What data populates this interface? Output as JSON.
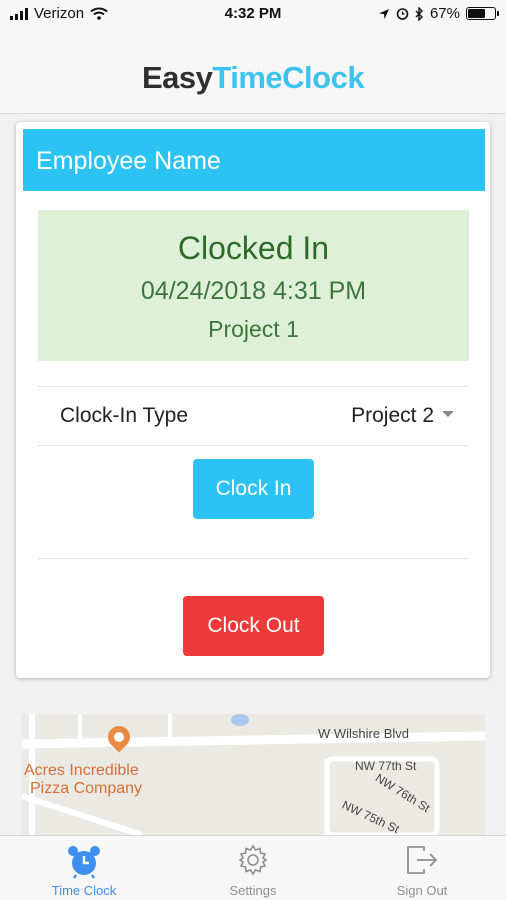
{
  "status_bar": {
    "carrier": "Verizon",
    "time": "4:32 PM",
    "battery": "67%",
    "battery_level": 0.67
  },
  "header": {
    "logo_part1": "Easy",
    "logo_part2": "TimeClock"
  },
  "card": {
    "title": "Employee Name",
    "status": {
      "title": "Clocked In",
      "datetime": "04/24/2018 4:31 PM",
      "project": "Project 1"
    },
    "clock_in_type": {
      "label": "Clock-In Type",
      "selected": "Project 2"
    },
    "clock_in_button": "Clock In",
    "clock_out_button": "Clock Out"
  },
  "map": {
    "place_line1": "Acres Incredible",
    "place_line2": "Pizza Company",
    "streets": [
      "W Wilshire Blvd",
      "NW 77th St",
      "NW 76th St",
      "NW 75th St"
    ]
  },
  "tab_bar": {
    "tabs": [
      {
        "label": "Time Clock",
        "icon": "alarm-clock-icon",
        "active": true
      },
      {
        "label": "Settings",
        "icon": "gear-icon",
        "active": false
      },
      {
        "label": "Sign Out",
        "icon": "sign-out-icon",
        "active": false
      }
    ]
  },
  "colors": {
    "accent": "#2cc3f4",
    "danger": "#ee3a3a",
    "success_bg": "#dff0d8",
    "success_text": "#3c763d",
    "tab_active": "#3e8ff0"
  }
}
